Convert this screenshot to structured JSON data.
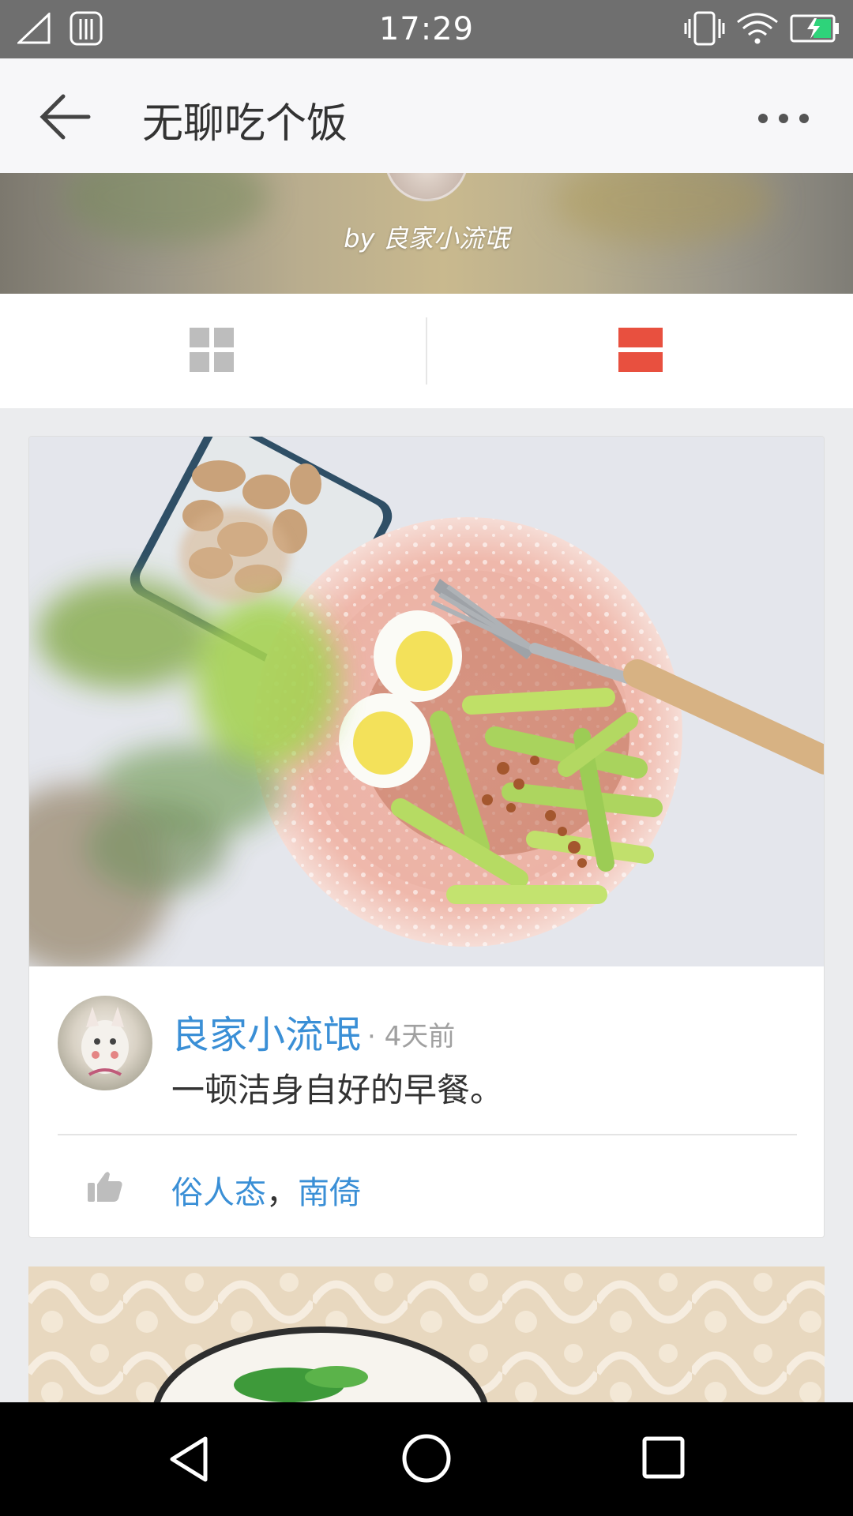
{
  "status_bar": {
    "time": "17:29"
  },
  "app_bar": {
    "title": "无聊吃个饭"
  },
  "cover": {
    "byline": "by 良家小流氓"
  },
  "post": {
    "author": "良家小流氓",
    "time_ago": "· 4天前",
    "text": "一顿洁身自好的早餐。",
    "likers": [
      "俗人态",
      "南倚"
    ],
    "liker_separator": "，"
  },
  "colors": {
    "accent_link": "#3a8fd6",
    "toggle_active": "#e8503f",
    "toggle_inactive": "#bdbdbd"
  },
  "icons": {
    "back": "arrow-left-icon",
    "more": "more-dots-icon",
    "grid_view": "grid-view-icon",
    "list_view": "list-view-icon",
    "like": "thumbs-up-icon"
  }
}
